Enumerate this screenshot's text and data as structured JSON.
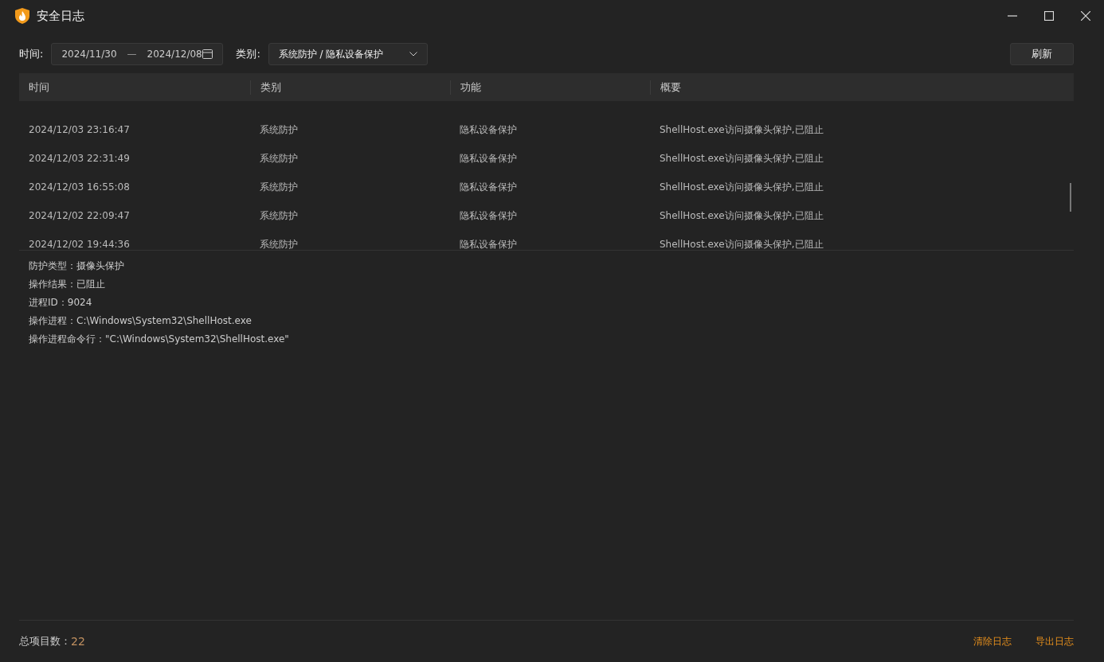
{
  "window": {
    "title": "安全日志"
  },
  "filters": {
    "time_label": "时间:",
    "date_start": "2024/11/30",
    "date_separator": "—",
    "date_end": "2024/12/08",
    "category_label": "类别:",
    "category_value": "系统防护 / 隐私设备保护"
  },
  "refresh_button": "刷新",
  "table": {
    "columns": [
      "时间",
      "类别",
      "功能",
      "概要"
    ],
    "rows": [
      {
        "cells": [
          "2024/12/03 23:16:47",
          "系统防护",
          "隐私设备保护",
          "ShellHost.exe访问摄像头保护,已阻止"
        ]
      },
      {
        "cells": [
          "2024/12/03 22:31:49",
          "系统防护",
          "隐私设备保护",
          "ShellHost.exe访问摄像头保护,已阻止"
        ]
      },
      {
        "cells": [
          "2024/12/03 16:55:08",
          "系统防护",
          "隐私设备保护",
          "ShellHost.exe访问摄像头保护,已阻止"
        ]
      },
      {
        "cells": [
          "2024/12/02 22:09:47",
          "系统防护",
          "隐私设备保护",
          "ShellHost.exe访问摄像头保护,已阻止"
        ]
      },
      {
        "cells": [
          "2024/12/02 19:44:36",
          "系统防护",
          "隐私设备保护",
          "ShellHost.exe访问摄像头保护,已阻止"
        ]
      }
    ]
  },
  "details": [
    "防护类型：摄像头保护",
    "操作结果：已阻止",
    "进程ID：9024",
    "操作进程：C:\\Windows\\System32\\ShellHost.exe",
    "操作进程命令行：\"C:\\Windows\\System32\\ShellHost.exe\""
  ],
  "footer": {
    "count_label": "总项目数：",
    "count": "22",
    "actions": [
      "清除日志",
      "导出日志"
    ]
  }
}
